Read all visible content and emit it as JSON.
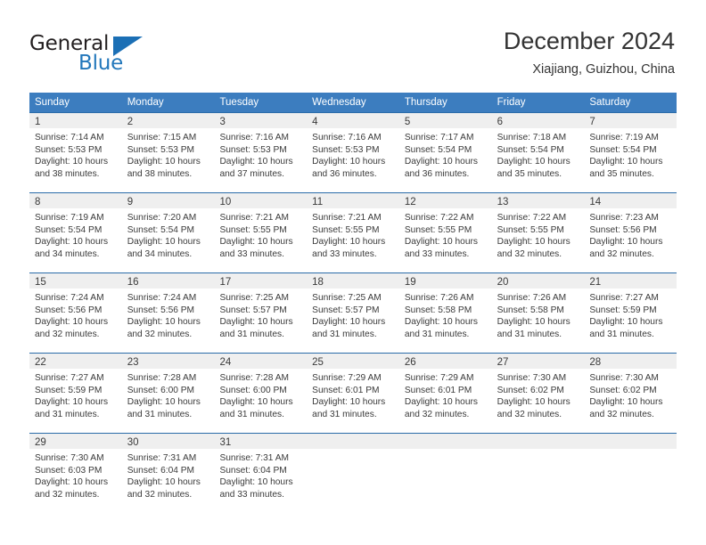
{
  "brand": {
    "name_part1": "General",
    "name_part2": "Blue",
    "triangle_color": "#1b6fb5",
    "blue_text_color": "#2277bb"
  },
  "header": {
    "title": "December 2024",
    "subtitle": "Xiajiang, Guizhou, China"
  },
  "theme": {
    "header_row_bg": "#3c7dbf",
    "row_divider": "#2b6ca9",
    "day_number_bg": "#efefef",
    "text_color": "#3a3a3a"
  },
  "weekdays": [
    "Sunday",
    "Monday",
    "Tuesday",
    "Wednesday",
    "Thursday",
    "Friday",
    "Saturday"
  ],
  "weeks": [
    [
      {
        "day": "1",
        "sunrise": "Sunrise: 7:14 AM",
        "sunset": "Sunset: 5:53 PM",
        "daylight1": "Daylight: 10 hours",
        "daylight2": "and 38 minutes."
      },
      {
        "day": "2",
        "sunrise": "Sunrise: 7:15 AM",
        "sunset": "Sunset: 5:53 PM",
        "daylight1": "Daylight: 10 hours",
        "daylight2": "and 38 minutes."
      },
      {
        "day": "3",
        "sunrise": "Sunrise: 7:16 AM",
        "sunset": "Sunset: 5:53 PM",
        "daylight1": "Daylight: 10 hours",
        "daylight2": "and 37 minutes."
      },
      {
        "day": "4",
        "sunrise": "Sunrise: 7:16 AM",
        "sunset": "Sunset: 5:53 PM",
        "daylight1": "Daylight: 10 hours",
        "daylight2": "and 36 minutes."
      },
      {
        "day": "5",
        "sunrise": "Sunrise: 7:17 AM",
        "sunset": "Sunset: 5:54 PM",
        "daylight1": "Daylight: 10 hours",
        "daylight2": "and 36 minutes."
      },
      {
        "day": "6",
        "sunrise": "Sunrise: 7:18 AM",
        "sunset": "Sunset: 5:54 PM",
        "daylight1": "Daylight: 10 hours",
        "daylight2": "and 35 minutes."
      },
      {
        "day": "7",
        "sunrise": "Sunrise: 7:19 AM",
        "sunset": "Sunset: 5:54 PM",
        "daylight1": "Daylight: 10 hours",
        "daylight2": "and 35 minutes."
      }
    ],
    [
      {
        "day": "8",
        "sunrise": "Sunrise: 7:19 AM",
        "sunset": "Sunset: 5:54 PM",
        "daylight1": "Daylight: 10 hours",
        "daylight2": "and 34 minutes."
      },
      {
        "day": "9",
        "sunrise": "Sunrise: 7:20 AM",
        "sunset": "Sunset: 5:54 PM",
        "daylight1": "Daylight: 10 hours",
        "daylight2": "and 34 minutes."
      },
      {
        "day": "10",
        "sunrise": "Sunrise: 7:21 AM",
        "sunset": "Sunset: 5:55 PM",
        "daylight1": "Daylight: 10 hours",
        "daylight2": "and 33 minutes."
      },
      {
        "day": "11",
        "sunrise": "Sunrise: 7:21 AM",
        "sunset": "Sunset: 5:55 PM",
        "daylight1": "Daylight: 10 hours",
        "daylight2": "and 33 minutes."
      },
      {
        "day": "12",
        "sunrise": "Sunrise: 7:22 AM",
        "sunset": "Sunset: 5:55 PM",
        "daylight1": "Daylight: 10 hours",
        "daylight2": "and 33 minutes."
      },
      {
        "day": "13",
        "sunrise": "Sunrise: 7:22 AM",
        "sunset": "Sunset: 5:55 PM",
        "daylight1": "Daylight: 10 hours",
        "daylight2": "and 32 minutes."
      },
      {
        "day": "14",
        "sunrise": "Sunrise: 7:23 AM",
        "sunset": "Sunset: 5:56 PM",
        "daylight1": "Daylight: 10 hours",
        "daylight2": "and 32 minutes."
      }
    ],
    [
      {
        "day": "15",
        "sunrise": "Sunrise: 7:24 AM",
        "sunset": "Sunset: 5:56 PM",
        "daylight1": "Daylight: 10 hours",
        "daylight2": "and 32 minutes."
      },
      {
        "day": "16",
        "sunrise": "Sunrise: 7:24 AM",
        "sunset": "Sunset: 5:56 PM",
        "daylight1": "Daylight: 10 hours",
        "daylight2": "and 32 minutes."
      },
      {
        "day": "17",
        "sunrise": "Sunrise: 7:25 AM",
        "sunset": "Sunset: 5:57 PM",
        "daylight1": "Daylight: 10 hours",
        "daylight2": "and 31 minutes."
      },
      {
        "day": "18",
        "sunrise": "Sunrise: 7:25 AM",
        "sunset": "Sunset: 5:57 PM",
        "daylight1": "Daylight: 10 hours",
        "daylight2": "and 31 minutes."
      },
      {
        "day": "19",
        "sunrise": "Sunrise: 7:26 AM",
        "sunset": "Sunset: 5:58 PM",
        "daylight1": "Daylight: 10 hours",
        "daylight2": "and 31 minutes."
      },
      {
        "day": "20",
        "sunrise": "Sunrise: 7:26 AM",
        "sunset": "Sunset: 5:58 PM",
        "daylight1": "Daylight: 10 hours",
        "daylight2": "and 31 minutes."
      },
      {
        "day": "21",
        "sunrise": "Sunrise: 7:27 AM",
        "sunset": "Sunset: 5:59 PM",
        "daylight1": "Daylight: 10 hours",
        "daylight2": "and 31 minutes."
      }
    ],
    [
      {
        "day": "22",
        "sunrise": "Sunrise: 7:27 AM",
        "sunset": "Sunset: 5:59 PM",
        "daylight1": "Daylight: 10 hours",
        "daylight2": "and 31 minutes."
      },
      {
        "day": "23",
        "sunrise": "Sunrise: 7:28 AM",
        "sunset": "Sunset: 6:00 PM",
        "daylight1": "Daylight: 10 hours",
        "daylight2": "and 31 minutes."
      },
      {
        "day": "24",
        "sunrise": "Sunrise: 7:28 AM",
        "sunset": "Sunset: 6:00 PM",
        "daylight1": "Daylight: 10 hours",
        "daylight2": "and 31 minutes."
      },
      {
        "day": "25",
        "sunrise": "Sunrise: 7:29 AM",
        "sunset": "Sunset: 6:01 PM",
        "daylight1": "Daylight: 10 hours",
        "daylight2": "and 31 minutes."
      },
      {
        "day": "26",
        "sunrise": "Sunrise: 7:29 AM",
        "sunset": "Sunset: 6:01 PM",
        "daylight1": "Daylight: 10 hours",
        "daylight2": "and 32 minutes."
      },
      {
        "day": "27",
        "sunrise": "Sunrise: 7:30 AM",
        "sunset": "Sunset: 6:02 PM",
        "daylight1": "Daylight: 10 hours",
        "daylight2": "and 32 minutes."
      },
      {
        "day": "28",
        "sunrise": "Sunrise: 7:30 AM",
        "sunset": "Sunset: 6:02 PM",
        "daylight1": "Daylight: 10 hours",
        "daylight2": "and 32 minutes."
      }
    ],
    [
      {
        "day": "29",
        "sunrise": "Sunrise: 7:30 AM",
        "sunset": "Sunset: 6:03 PM",
        "daylight1": "Daylight: 10 hours",
        "daylight2": "and 32 minutes."
      },
      {
        "day": "30",
        "sunrise": "Sunrise: 7:31 AM",
        "sunset": "Sunset: 6:04 PM",
        "daylight1": "Daylight: 10 hours",
        "daylight2": "and 32 minutes."
      },
      {
        "day": "31",
        "sunrise": "Sunrise: 7:31 AM",
        "sunset": "Sunset: 6:04 PM",
        "daylight1": "Daylight: 10 hours",
        "daylight2": "and 33 minutes."
      },
      {
        "day": "",
        "sunrise": "",
        "sunset": "",
        "daylight1": "",
        "daylight2": ""
      },
      {
        "day": "",
        "sunrise": "",
        "sunset": "",
        "daylight1": "",
        "daylight2": ""
      },
      {
        "day": "",
        "sunrise": "",
        "sunset": "",
        "daylight1": "",
        "daylight2": ""
      },
      {
        "day": "",
        "sunrise": "",
        "sunset": "",
        "daylight1": "",
        "daylight2": ""
      }
    ]
  ]
}
